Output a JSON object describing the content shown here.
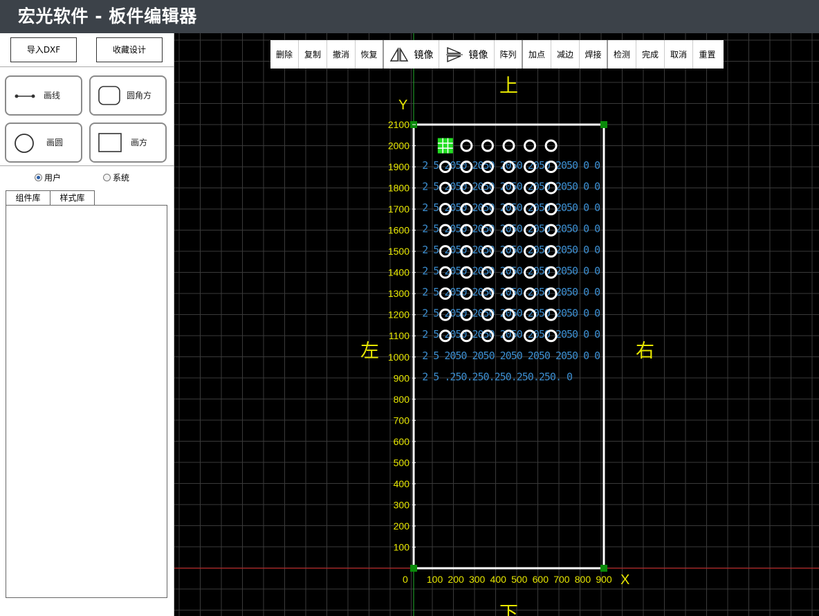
{
  "window": {
    "title": "宏光软件 - 板件编辑器"
  },
  "sidebar": {
    "import_label": "导入DXF",
    "favorite_label": "收藏设计",
    "tools": [
      {
        "label": "画线"
      },
      {
        "label": "圆角方"
      },
      {
        "label": "画圆"
      },
      {
        "label": "画方"
      }
    ],
    "scope": {
      "options": [
        "用户",
        "系统"
      ],
      "selected": "用户"
    },
    "tabs": [
      "组件库",
      "样式库"
    ]
  },
  "toolbar": {
    "items": [
      "删除",
      "复制",
      "撤消",
      "恢复",
      "镜像",
      "镜像",
      "阵列",
      "加点",
      "减边",
      "焊接",
      "检测",
      "完成",
      "取消",
      "重置"
    ]
  },
  "canvas": {
    "directions": {
      "top": "上",
      "bottom": "下",
      "left": "左",
      "right": "右"
    },
    "axis": {
      "x_label": "X",
      "y_label": "Y",
      "origin_label": "0"
    },
    "x_ticks": [
      100,
      200,
      300,
      400,
      500,
      600,
      700,
      800,
      900
    ],
    "y_ticks": [
      100,
      200,
      300,
      400,
      500,
      600,
      700,
      800,
      900,
      1000,
      1100,
      1200,
      1300,
      1400,
      1500,
      1600,
      1700,
      1800,
      1900,
      2000,
      2100
    ],
    "board": {
      "width": 900,
      "height": 2100
    },
    "holes": {
      "start_x": 150,
      "start_y": 2000,
      "step_x": 100,
      "step_y": 100,
      "cols": 6,
      "rows": 10,
      "selected_first": true
    },
    "dimension_rows": [
      "2 5  2050 2050 2050 2050 2050 0 0",
      "2 5  2050 2050 2050 2050 2050 0 0",
      "2 5  2050 2050 2050 2050 2050 0 0",
      "2 5  2050 2050 2050 2050 2050 0 0",
      "2 5  2050 2050 2050 2050 2050 0 0",
      "2 5  2050 2050 2050 2050 2050 0 0",
      "2 5  2050 2050 2050 2050 2050 0 0",
      "2 5  2050 2050 2050 2050 2050 0 0",
      "2 5  2050 2050 2050 2050 2050 0 0",
      "2 5  2050 2050 2050 2050 2050 0 0",
      "2 5  .250.250.250.250.250.  0"
    ],
    "colors": {
      "grid": "#3a3a3a",
      "board": "#ffffff",
      "hole": "#ffffff",
      "axis_x": "#d21f1f",
      "axis_y": "#22b02b",
      "labels": "#e6e600",
      "dimension": "#3d8fd1",
      "handle": "#0a8a0a",
      "selected": "#22dd22"
    }
  }
}
